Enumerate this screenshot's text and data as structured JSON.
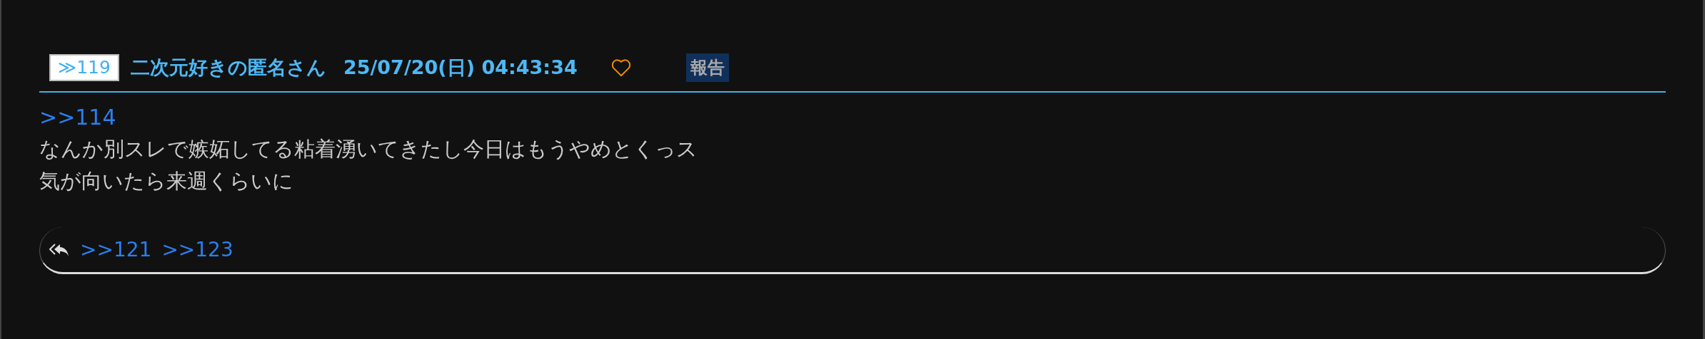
{
  "post": {
    "number": "≫119",
    "name": "二次元好きの匿名さん",
    "date": "25/07/20(日) 04:43:34",
    "liked": false,
    "report": "報告",
    "anchor": ">>114",
    "lines": [
      "なんか別スレで嫉妬してる粘着湧いてきたし今日はもうやめとくっス",
      "気が向いたら来週くらいに"
    ],
    "replies": [
      ">>121",
      ">>123"
    ]
  }
}
